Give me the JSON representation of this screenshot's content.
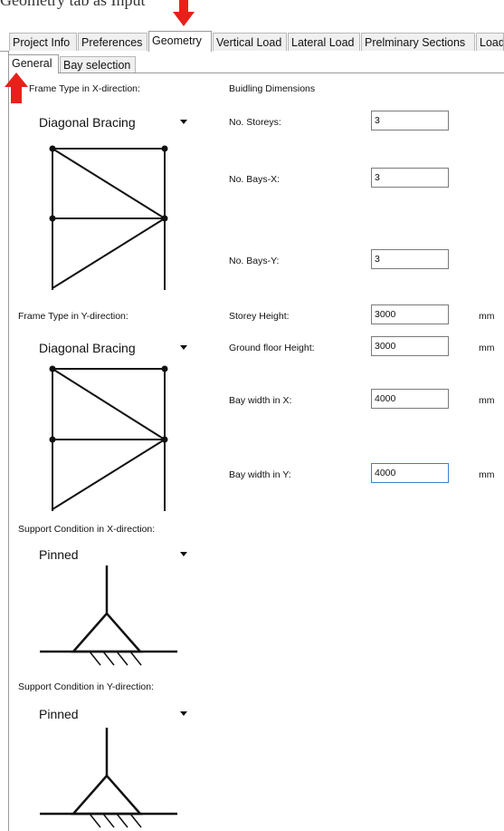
{
  "caption": "Geometry tab as Input",
  "tabs": [
    {
      "label": "Project Info"
    },
    {
      "label": "Preferences"
    },
    {
      "label": "Geometry"
    },
    {
      "label": "Vertical Load"
    },
    {
      "label": "Lateral Load"
    },
    {
      "label": "Prelminary Sections"
    },
    {
      "label": "Load"
    }
  ],
  "subtabs": [
    {
      "label": "General"
    },
    {
      "label": "Bay selection"
    }
  ],
  "left": {
    "frame_x_label": "Frame Type in X-direction:",
    "frame_x_value": "Diagonal Bracing",
    "frame_y_label": "Frame Type in Y-direction:",
    "frame_y_value": "Diagonal Bracing",
    "support_x_label": "Support Condition in X-direction:",
    "support_x_value": "Pinned",
    "support_y_label": "Support Condition in Y-direction:",
    "support_y_value": "Pinned"
  },
  "right": {
    "heading": "Buidling Dimensions",
    "storeys_label": "No. Storeys:",
    "storeys_value": "3",
    "bays_x_label": "No. Bays-X:",
    "bays_x_value": "3",
    "bays_y_label": "No. Bays-Y:",
    "bays_y_value": "3",
    "storey_h_label": "Storey Height:",
    "storey_h_value": "3000",
    "ground_h_label": "Ground floor Height:",
    "ground_h_value": "3000",
    "bay_wx_label": "Bay width in X:",
    "bay_wx_value": "4000",
    "bay_wy_label": "Bay width in Y:",
    "bay_wy_value": "4000",
    "unit": "mm"
  },
  "colors": {
    "arrow": "#e8201a",
    "focus": "#3c7fd0"
  }
}
